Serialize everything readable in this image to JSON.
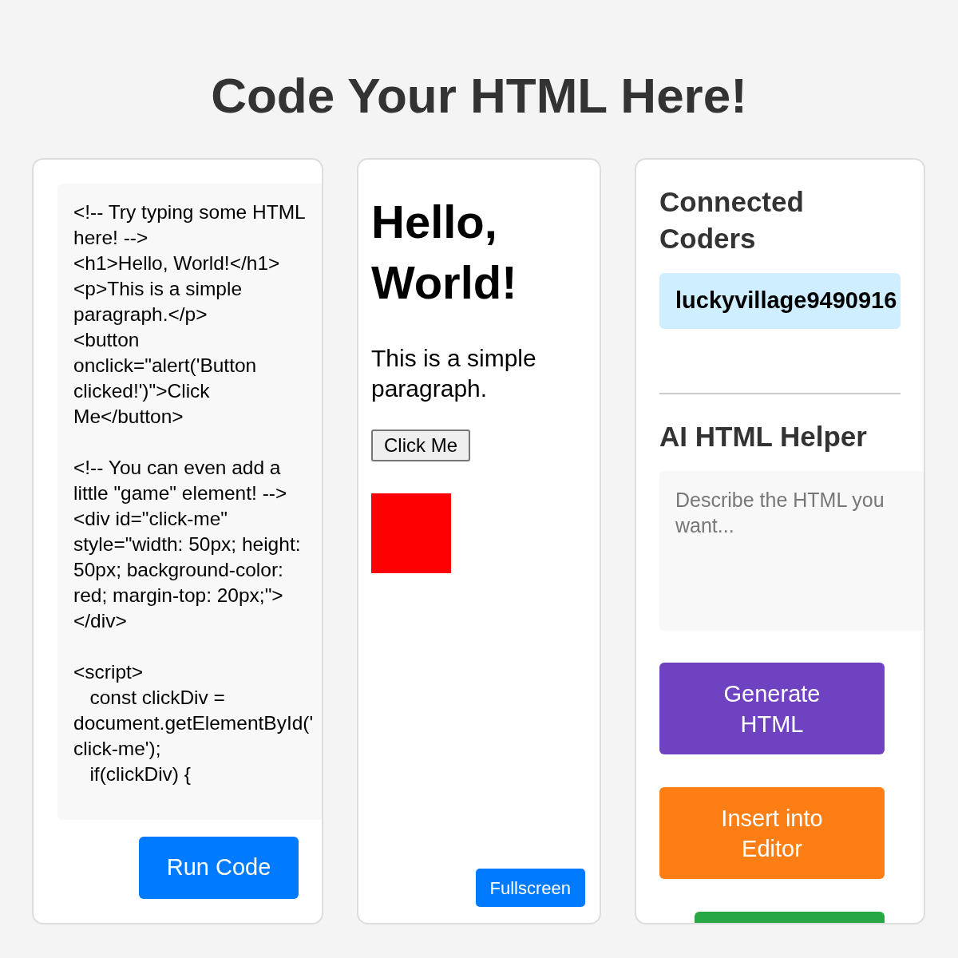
{
  "title": "Code Your HTML Here!",
  "editor": {
    "value": "<!-- Try typing some HTML here! -->\n<h1>Hello, World!</h1>\n<p>This is a simple paragraph.</p>\n<button onclick=\"alert('Button clicked!')\">Click Me</button>\n\n<!-- You can even add a little \"game\" element! -->\n<div id=\"click-me\" style=\"width: 50px; height: 50px; background-color: red; margin-top: 20px;\"></div>\n\n<script>\n   const clickDiv = document.getElementById('click-me');\n   if(clickDiv) {",
    "run_button": "Run Code"
  },
  "preview": {
    "heading": "Hello, World!",
    "paragraph": "This is a simple paragraph.",
    "button": "Click Me",
    "fullscreen_button": "Fullscreen"
  },
  "sidebar": {
    "coders_title": "Connected Coders",
    "coders": [
      "luckyvillage9490916"
    ],
    "helper_title": "AI HTML Helper",
    "prompt": {
      "placeholder": "Describe the HTML you want..."
    },
    "actions": [
      {
        "label": "Generate HTML",
        "color": "#6f42c1"
      },
      {
        "label": "Insert into Editor",
        "color": "#fd7e14"
      },
      {
        "color": "#28a745"
      }
    ]
  }
}
